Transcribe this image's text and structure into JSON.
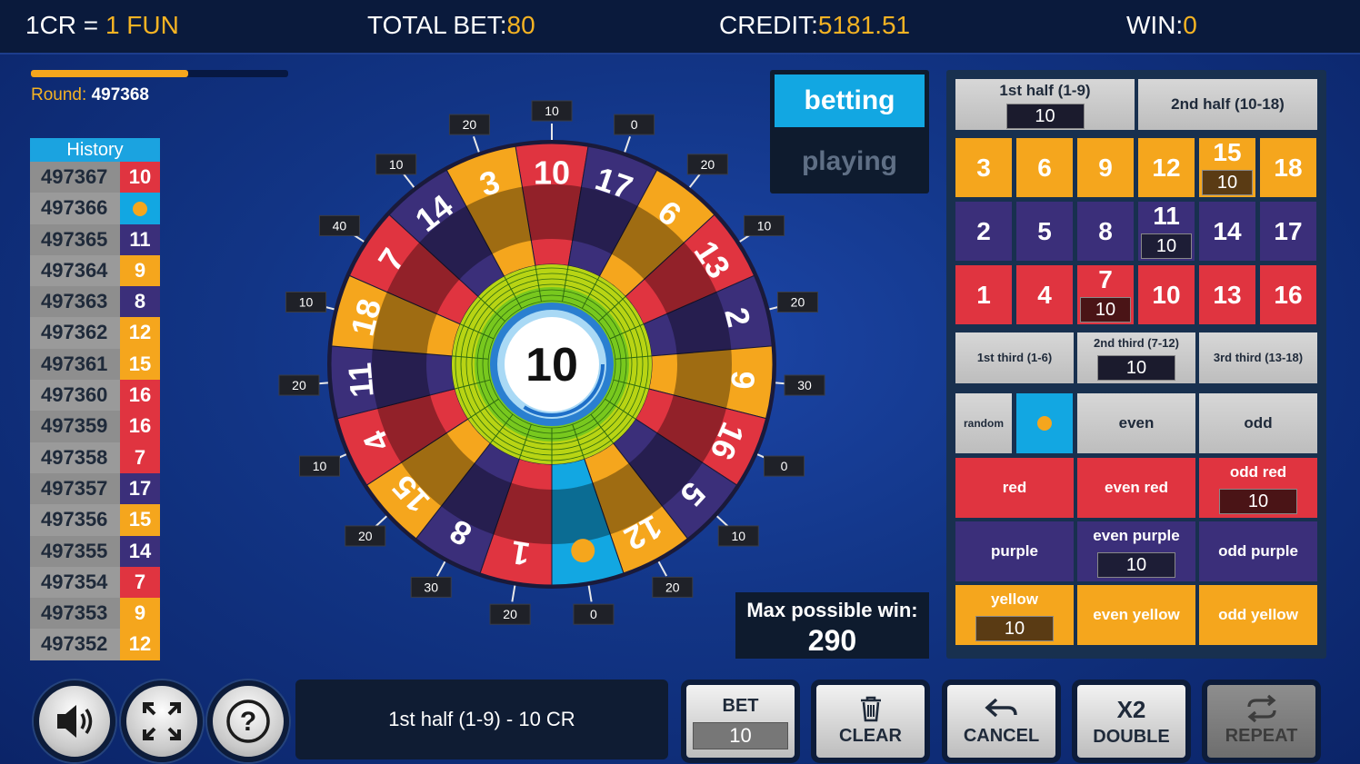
{
  "topbar": {
    "rate_label": "1CR =",
    "rate_value": "1 FUN",
    "total_bet_label": "TOTAL BET:",
    "total_bet_value": "80",
    "credit_label": "CREDIT:",
    "credit_value": "5181.51",
    "win_label": "WIN:",
    "win_value": "0"
  },
  "round": {
    "label": "Round:",
    "value": "497368",
    "progress": 0.61
  },
  "history": {
    "title": "History",
    "rows": [
      {
        "id": "497367",
        "result": "10",
        "color": "#e03440"
      },
      {
        "id": "497366",
        "result": "",
        "dot": true,
        "color": "#12a7e2"
      },
      {
        "id": "497365",
        "result": "11",
        "color": "#3b2f7a"
      },
      {
        "id": "497364",
        "result": "9",
        "color": "#f5a61d"
      },
      {
        "id": "497363",
        "result": "8",
        "color": "#3b2f7a"
      },
      {
        "id": "497362",
        "result": "12",
        "color": "#f5a61d"
      },
      {
        "id": "497361",
        "result": "15",
        "color": "#f5a61d"
      },
      {
        "id": "497360",
        "result": "16",
        "color": "#e03440"
      },
      {
        "id": "497359",
        "result": "16",
        "color": "#e03440"
      },
      {
        "id": "497358",
        "result": "7",
        "color": "#e03440"
      },
      {
        "id": "497357",
        "result": "17",
        "color": "#3b2f7a"
      },
      {
        "id": "497356",
        "result": "15",
        "color": "#f5a61d"
      },
      {
        "id": "497355",
        "result": "14",
        "color": "#3b2f7a"
      },
      {
        "id": "497354",
        "result": "7",
        "color": "#e03440"
      },
      {
        "id": "497353",
        "result": "9",
        "color": "#f5a61d"
      },
      {
        "id": "497352",
        "result": "12",
        "color": "#f5a61d"
      }
    ]
  },
  "wheel": {
    "center_value": "10",
    "segments": [
      {
        "label": "10",
        "color": "#e03440",
        "odds": "10"
      },
      {
        "label": "17",
        "color": "#3b2f7a",
        "odds": "0"
      },
      {
        "label": "6",
        "color": "#f5a61d",
        "odds": "20"
      },
      {
        "label": "13",
        "color": "#e03440",
        "odds": "10"
      },
      {
        "label": "2",
        "color": "#3b2f7a",
        "odds": "20"
      },
      {
        "label": "9",
        "color": "#f5a61d",
        "odds": "30"
      },
      {
        "label": "16",
        "color": "#e03440",
        "odds": "0"
      },
      {
        "label": "5",
        "color": "#3b2f7a",
        "odds": "10"
      },
      {
        "label": "12",
        "color": "#f5a61d",
        "odds": "20"
      },
      {
        "label": "",
        "color": "#12a7e2",
        "odds": "0",
        "dot": true
      },
      {
        "label": "1",
        "color": "#e03440",
        "odds": "20"
      },
      {
        "label": "8",
        "color": "#3b2f7a",
        "odds": "30"
      },
      {
        "label": "15",
        "color": "#f5a61d",
        "odds": "20"
      },
      {
        "label": "4",
        "color": "#e03440",
        "odds": "10"
      },
      {
        "label": "11",
        "color": "#3b2f7a",
        "odds": "20"
      },
      {
        "label": "18",
        "color": "#f5a61d",
        "odds": "10"
      },
      {
        "label": "7",
        "color": "#e03440",
        "odds": "40"
      },
      {
        "label": "14",
        "color": "#3b2f7a",
        "odds": "10"
      },
      {
        "label": "3",
        "color": "#f5a61d",
        "odds": "20"
      }
    ]
  },
  "mode": {
    "betting": "betting",
    "playing": "playing"
  },
  "max_win": {
    "label": "Max possible win:",
    "value": "290"
  },
  "board": {
    "first_half": "1st half (1-9)",
    "first_half_bet": "10",
    "second_half": "2nd half (10-18)",
    "numbers": {
      "n3": "3",
      "n6": "6",
      "n9": "9",
      "n12": "12",
      "n15": "15",
      "n18": "18",
      "n2": "2",
      "n5": "5",
      "n8": "8",
      "n11": "11",
      "n14": "14",
      "n17": "17",
      "n1": "1",
      "n4": "4",
      "n7": "7",
      "n10": "10",
      "n13": "13",
      "n16": "16"
    },
    "bets": {
      "n15": "10",
      "n11": "10",
      "n7": "10"
    },
    "first_third": "1st third (1-6)",
    "second_third": "2nd third (7-12)",
    "second_third_bet": "10",
    "third_third": "3rd third (13-18)",
    "random": "random",
    "even": "even",
    "odd": "odd",
    "red": "red",
    "even_red": "even red",
    "odd_red": "odd red",
    "odd_red_bet": "10",
    "purple": "purple",
    "even_purple": "even purple",
    "even_purple_bet": "10",
    "odd_purple": "odd purple",
    "yellow": "yellow",
    "yellow_bet": "10",
    "even_yellow": "even yellow",
    "odd_yellow": "odd yellow"
  },
  "info_text": "1st half (1-9) - 10 CR",
  "actions": {
    "bet_label": "BET",
    "bet_value": "10",
    "clear": "CLEAR",
    "cancel": "CANCEL",
    "double_top": "X2",
    "double": "DOUBLE",
    "repeat": "REPEAT"
  },
  "icons": [
    "sound-icon",
    "fullscreen-icon",
    "help-icon",
    "trash-icon",
    "undo-icon",
    "repeat-icon"
  ]
}
